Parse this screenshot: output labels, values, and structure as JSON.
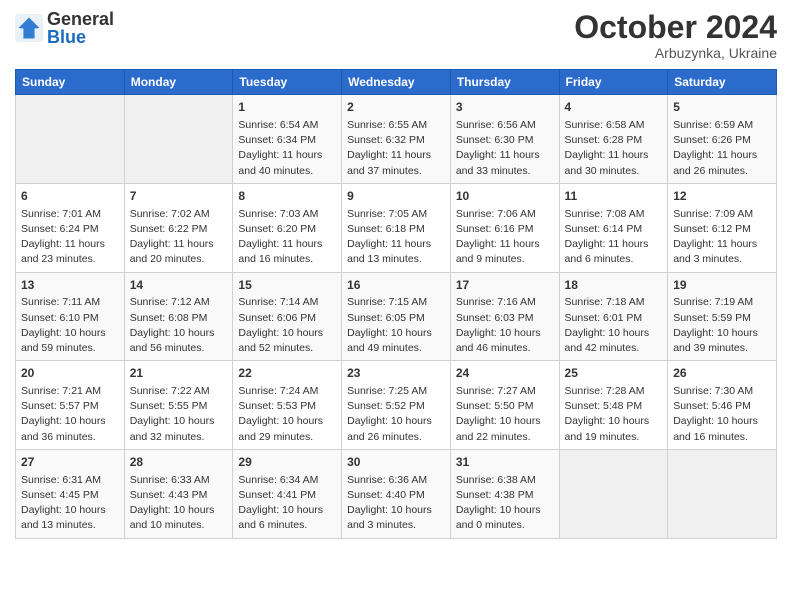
{
  "header": {
    "logo_general": "General",
    "logo_blue": "Blue",
    "month_title": "October 2024",
    "subtitle": "Arbuzynka, Ukraine"
  },
  "days_of_week": [
    "Sunday",
    "Monday",
    "Tuesday",
    "Wednesday",
    "Thursday",
    "Friday",
    "Saturday"
  ],
  "weeks": [
    [
      {
        "day": "",
        "info": ""
      },
      {
        "day": "",
        "info": ""
      },
      {
        "day": "1",
        "info": "Sunrise: 6:54 AM\nSunset: 6:34 PM\nDaylight: 11 hours\nand 40 minutes."
      },
      {
        "day": "2",
        "info": "Sunrise: 6:55 AM\nSunset: 6:32 PM\nDaylight: 11 hours\nand 37 minutes."
      },
      {
        "day": "3",
        "info": "Sunrise: 6:56 AM\nSunset: 6:30 PM\nDaylight: 11 hours\nand 33 minutes."
      },
      {
        "day": "4",
        "info": "Sunrise: 6:58 AM\nSunset: 6:28 PM\nDaylight: 11 hours\nand 30 minutes."
      },
      {
        "day": "5",
        "info": "Sunrise: 6:59 AM\nSunset: 6:26 PM\nDaylight: 11 hours\nand 26 minutes."
      }
    ],
    [
      {
        "day": "6",
        "info": "Sunrise: 7:01 AM\nSunset: 6:24 PM\nDaylight: 11 hours\nand 23 minutes."
      },
      {
        "day": "7",
        "info": "Sunrise: 7:02 AM\nSunset: 6:22 PM\nDaylight: 11 hours\nand 20 minutes."
      },
      {
        "day": "8",
        "info": "Sunrise: 7:03 AM\nSunset: 6:20 PM\nDaylight: 11 hours\nand 16 minutes."
      },
      {
        "day": "9",
        "info": "Sunrise: 7:05 AM\nSunset: 6:18 PM\nDaylight: 11 hours\nand 13 minutes."
      },
      {
        "day": "10",
        "info": "Sunrise: 7:06 AM\nSunset: 6:16 PM\nDaylight: 11 hours\nand 9 minutes."
      },
      {
        "day": "11",
        "info": "Sunrise: 7:08 AM\nSunset: 6:14 PM\nDaylight: 11 hours\nand 6 minutes."
      },
      {
        "day": "12",
        "info": "Sunrise: 7:09 AM\nSunset: 6:12 PM\nDaylight: 11 hours\nand 3 minutes."
      }
    ],
    [
      {
        "day": "13",
        "info": "Sunrise: 7:11 AM\nSunset: 6:10 PM\nDaylight: 10 hours\nand 59 minutes."
      },
      {
        "day": "14",
        "info": "Sunrise: 7:12 AM\nSunset: 6:08 PM\nDaylight: 10 hours\nand 56 minutes."
      },
      {
        "day": "15",
        "info": "Sunrise: 7:14 AM\nSunset: 6:06 PM\nDaylight: 10 hours\nand 52 minutes."
      },
      {
        "day": "16",
        "info": "Sunrise: 7:15 AM\nSunset: 6:05 PM\nDaylight: 10 hours\nand 49 minutes."
      },
      {
        "day": "17",
        "info": "Sunrise: 7:16 AM\nSunset: 6:03 PM\nDaylight: 10 hours\nand 46 minutes."
      },
      {
        "day": "18",
        "info": "Sunrise: 7:18 AM\nSunset: 6:01 PM\nDaylight: 10 hours\nand 42 minutes."
      },
      {
        "day": "19",
        "info": "Sunrise: 7:19 AM\nSunset: 5:59 PM\nDaylight: 10 hours\nand 39 minutes."
      }
    ],
    [
      {
        "day": "20",
        "info": "Sunrise: 7:21 AM\nSunset: 5:57 PM\nDaylight: 10 hours\nand 36 minutes."
      },
      {
        "day": "21",
        "info": "Sunrise: 7:22 AM\nSunset: 5:55 PM\nDaylight: 10 hours\nand 32 minutes."
      },
      {
        "day": "22",
        "info": "Sunrise: 7:24 AM\nSunset: 5:53 PM\nDaylight: 10 hours\nand 29 minutes."
      },
      {
        "day": "23",
        "info": "Sunrise: 7:25 AM\nSunset: 5:52 PM\nDaylight: 10 hours\nand 26 minutes."
      },
      {
        "day": "24",
        "info": "Sunrise: 7:27 AM\nSunset: 5:50 PM\nDaylight: 10 hours\nand 22 minutes."
      },
      {
        "day": "25",
        "info": "Sunrise: 7:28 AM\nSunset: 5:48 PM\nDaylight: 10 hours\nand 19 minutes."
      },
      {
        "day": "26",
        "info": "Sunrise: 7:30 AM\nSunset: 5:46 PM\nDaylight: 10 hours\nand 16 minutes."
      }
    ],
    [
      {
        "day": "27",
        "info": "Sunrise: 6:31 AM\nSunset: 4:45 PM\nDaylight: 10 hours\nand 13 minutes."
      },
      {
        "day": "28",
        "info": "Sunrise: 6:33 AM\nSunset: 4:43 PM\nDaylight: 10 hours\nand 10 minutes."
      },
      {
        "day": "29",
        "info": "Sunrise: 6:34 AM\nSunset: 4:41 PM\nDaylight: 10 hours\nand 6 minutes."
      },
      {
        "day": "30",
        "info": "Sunrise: 6:36 AM\nSunset: 4:40 PM\nDaylight: 10 hours\nand 3 minutes."
      },
      {
        "day": "31",
        "info": "Sunrise: 6:38 AM\nSunset: 4:38 PM\nDaylight: 10 hours\nand 0 minutes."
      },
      {
        "day": "",
        "info": ""
      },
      {
        "day": "",
        "info": ""
      }
    ]
  ]
}
